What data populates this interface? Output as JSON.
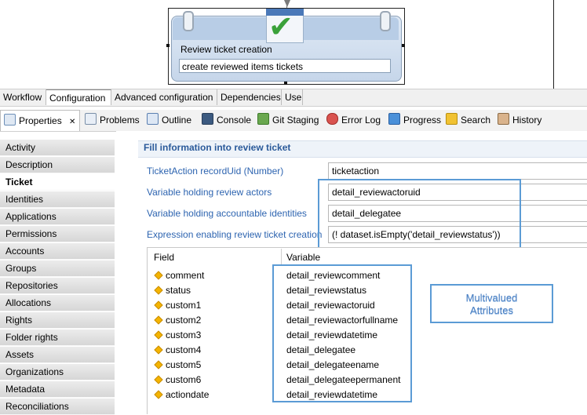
{
  "canvas": {
    "node": {
      "title": "Review ticket creation",
      "subtitle": "create reviewed items tickets",
      "icon": "calendar-check-icon"
    }
  },
  "editor_tabs": [
    {
      "label": "Workflow",
      "active": false
    },
    {
      "label": "Configuration",
      "active": true
    },
    {
      "label": "Advanced configuration",
      "active": false
    },
    {
      "label": "Dependencies",
      "active": false
    },
    {
      "label": "Use",
      "active": false
    }
  ],
  "views": {
    "properties": {
      "label": "Properties",
      "close": "✕"
    },
    "problems": {
      "label": "Problems"
    },
    "outline": {
      "label": "Outline"
    },
    "console": {
      "label": "Console"
    },
    "git_staging": {
      "label": "Git Staging"
    },
    "error_log": {
      "label": "Error Log"
    },
    "progress": {
      "label": "Progress"
    },
    "search": {
      "label": "Search"
    },
    "history": {
      "label": "History"
    }
  },
  "sidenav": {
    "items": [
      "Activity",
      "Description",
      "Ticket",
      "Identities",
      "Applications",
      "Permissions",
      "Accounts",
      "Groups",
      "Repositories",
      "Allocations",
      "Rights",
      "Folder rights",
      "Assets",
      "Organizations",
      "Metadata",
      "Reconciliations"
    ],
    "active": "Ticket"
  },
  "form": {
    "section_title": "Fill information into review ticket",
    "fields": [
      {
        "label": "TicketAction recordUid (Number)",
        "value": "ticketaction"
      },
      {
        "label": "Variable holding review actors",
        "value": "detail_reviewactoruid"
      },
      {
        "label": "Variable holding accountable identities",
        "value": "detail_delegatee"
      },
      {
        "label": "Expression enabling review ticket creation",
        "value": "(! dataset.isEmpty('detail_reviewstatus'))"
      }
    ]
  },
  "table": {
    "headers": {
      "field": "Field",
      "variable": "Variable"
    },
    "rows": [
      {
        "field": "comment",
        "variable": "detail_reviewcomment"
      },
      {
        "field": "status",
        "variable": "detail_reviewstatus"
      },
      {
        "field": "custom1",
        "variable": "detail_reviewactoruid"
      },
      {
        "field": "custom2",
        "variable": "detail_reviewactorfullname"
      },
      {
        "field": "custom3",
        "variable": "detail_reviewdatetime"
      },
      {
        "field": "custom4",
        "variable": "detail_delegatee"
      },
      {
        "field": "custom5",
        "variable": "detail_delegateename"
      },
      {
        "field": "custom6",
        "variable": "detail_delegateepermanent"
      },
      {
        "field": "actiondate",
        "variable": "detail_reviewdatetime"
      }
    ]
  },
  "note": {
    "line1": "Multivalued",
    "line2": "Attributes"
  },
  "colors": {
    "accent_blue": "#5b9bd5",
    "label_blue": "#2d64b0",
    "section_blue": "#2a5a9a"
  }
}
